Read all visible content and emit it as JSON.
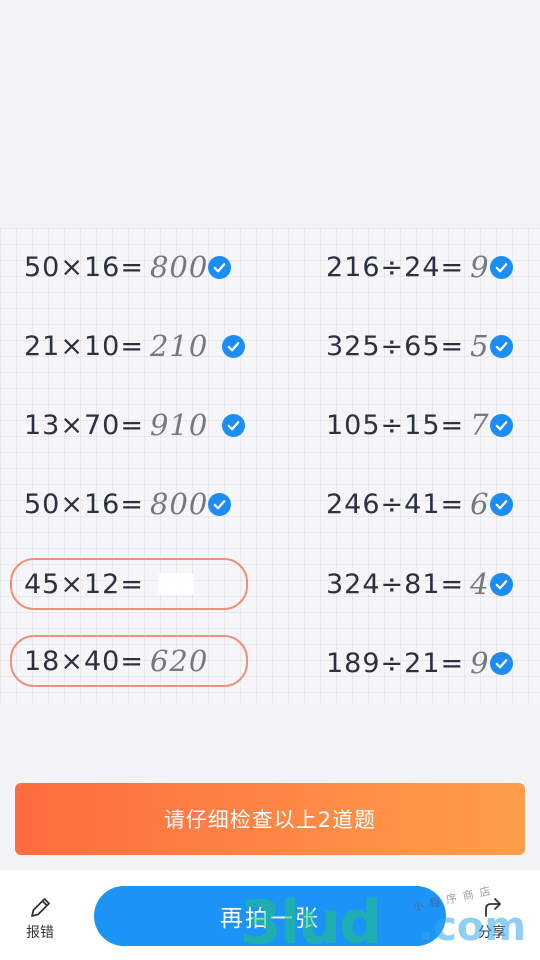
{
  "problems": [
    {
      "expr": "50×16=",
      "answer": "800",
      "status": "correct"
    },
    {
      "expr": "216÷24=",
      "answer": "9",
      "status": "correct"
    },
    {
      "expr": "21×10=",
      "answer": "210",
      "status": "correct"
    },
    {
      "expr": "325÷65=",
      "answer": "5",
      "status": "correct"
    },
    {
      "expr": "13×70=",
      "answer": "910",
      "status": "correct"
    },
    {
      "expr": "105÷15=",
      "answer": "7",
      "status": "correct"
    },
    {
      "expr": "50×16=",
      "answer": "800",
      "status": "correct"
    },
    {
      "expr": "246÷41=",
      "answer": "6",
      "status": "correct"
    },
    {
      "expr": "45×12=",
      "answer": "",
      "status": "flagged"
    },
    {
      "expr": "324÷81=",
      "answer": "4",
      "status": "correct"
    },
    {
      "expr": "18×40=",
      "answer": "620",
      "status": "flagged"
    },
    {
      "expr": "189÷21=",
      "answer": "9",
      "status": "correct"
    }
  ],
  "banner": {
    "text": "请仔细检查以上2道题"
  },
  "bottom": {
    "report_label": "报错",
    "retake_label": "再拍一张",
    "share_label": "分享"
  },
  "watermark": {
    "main": "3lud",
    "suffix": ".com",
    "small": "小程序商店"
  },
  "colors": {
    "accent": "#1c93f6",
    "check": "#1c8df5",
    "flag_ring": "#f0907a",
    "banner_start": "#ff6b3f",
    "banner_end": "#ff9e48"
  },
  "icons": {
    "report": "pencil-icon",
    "share": "share-arrow-icon",
    "check": "check-circle-icon"
  }
}
